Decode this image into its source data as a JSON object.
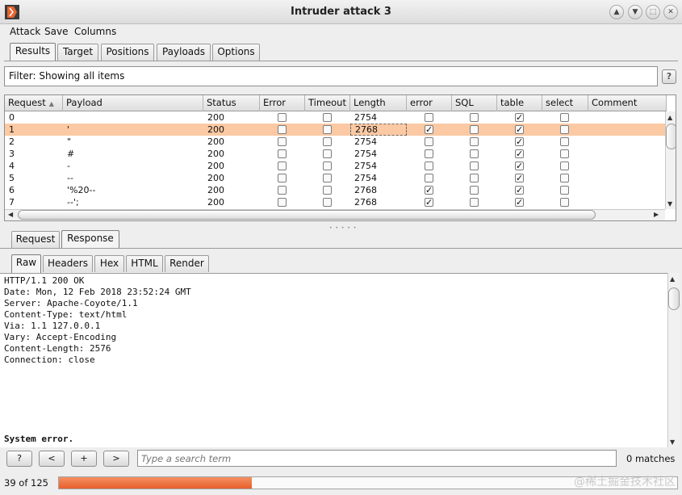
{
  "window": {
    "title": "Intruder attack 3",
    "controls": [
      "▲",
      "▼",
      "⬚",
      "✕"
    ]
  },
  "menu": [
    "Attack",
    "Save",
    "Columns"
  ],
  "main_tabs": [
    {
      "label": "Results",
      "active": true
    },
    {
      "label": "Target",
      "active": false
    },
    {
      "label": "Positions",
      "active": false
    },
    {
      "label": "Payloads",
      "active": false
    },
    {
      "label": "Options",
      "active": false
    }
  ],
  "filter": {
    "text": "Filter: Showing all items",
    "help": "?"
  },
  "table": {
    "columns": [
      "Request",
      "Payload",
      "Status",
      "Error",
      "Timeout",
      "Length",
      "error",
      "SQL",
      "table",
      "select",
      "Comment"
    ],
    "sort_column": "Request",
    "sort_icon": "sort-ascending-icon",
    "selected_row": 1,
    "rows": [
      {
        "request": "0",
        "payload": "",
        "status": "200",
        "error": false,
        "timeout": false,
        "length": "2754",
        "err": false,
        "sql": false,
        "table": true,
        "select": false,
        "comment": ""
      },
      {
        "request": "1",
        "payload": "'",
        "status": "200",
        "error": false,
        "timeout": false,
        "length": "2768",
        "err": true,
        "sql": false,
        "table": true,
        "select": false,
        "comment": ""
      },
      {
        "request": "2",
        "payload": "\"",
        "status": "200",
        "error": false,
        "timeout": false,
        "length": "2754",
        "err": false,
        "sql": false,
        "table": true,
        "select": false,
        "comment": ""
      },
      {
        "request": "3",
        "payload": "#",
        "status": "200",
        "error": false,
        "timeout": false,
        "length": "2754",
        "err": false,
        "sql": false,
        "table": true,
        "select": false,
        "comment": ""
      },
      {
        "request": "4",
        "payload": "-",
        "status": "200",
        "error": false,
        "timeout": false,
        "length": "2754",
        "err": false,
        "sql": false,
        "table": true,
        "select": false,
        "comment": ""
      },
      {
        "request": "5",
        "payload": "--",
        "status": "200",
        "error": false,
        "timeout": false,
        "length": "2754",
        "err": false,
        "sql": false,
        "table": true,
        "select": false,
        "comment": ""
      },
      {
        "request": "6",
        "payload": "'%20--",
        "status": "200",
        "error": false,
        "timeout": false,
        "length": "2768",
        "err": true,
        "sql": false,
        "table": true,
        "select": false,
        "comment": ""
      },
      {
        "request": "7",
        "payload": "--';",
        "status": "200",
        "error": false,
        "timeout": false,
        "length": "2768",
        "err": true,
        "sql": false,
        "table": true,
        "select": false,
        "comment": ""
      }
    ]
  },
  "req_resp_tabs": [
    {
      "label": "Request",
      "active": false
    },
    {
      "label": "Response",
      "active": true
    }
  ],
  "view_tabs": [
    {
      "label": "Raw",
      "active": true
    },
    {
      "label": "Headers",
      "active": false
    },
    {
      "label": "Hex",
      "active": false
    },
    {
      "label": "HTML",
      "active": false
    },
    {
      "label": "Render",
      "active": false
    }
  ],
  "response": {
    "lines": [
      "HTTP/1.1 200 OK",
      "Date: Mon, 12 Feb 2018 23:52:24 GMT",
      "Server: Apache-Coyote/1.1",
      "Content-Type: text/html",
      "Via: 1.1 127.0.0.1",
      "Vary: Accept-Encoding",
      "Content-Length: 2576",
      "Connection: close"
    ],
    "body_line": "System error."
  },
  "search": {
    "buttons": [
      "?",
      "<",
      "+",
      ">"
    ],
    "placeholder": "Type a search term",
    "matches": "0 matches"
  },
  "progress": {
    "label": "39 of 125",
    "fraction": 0.312
  },
  "watermark": "@稀土掘金技术社区",
  "colors": {
    "selected_row": "#fbc9a3",
    "progress": "#e8693a",
    "logo": "#e8642e"
  }
}
